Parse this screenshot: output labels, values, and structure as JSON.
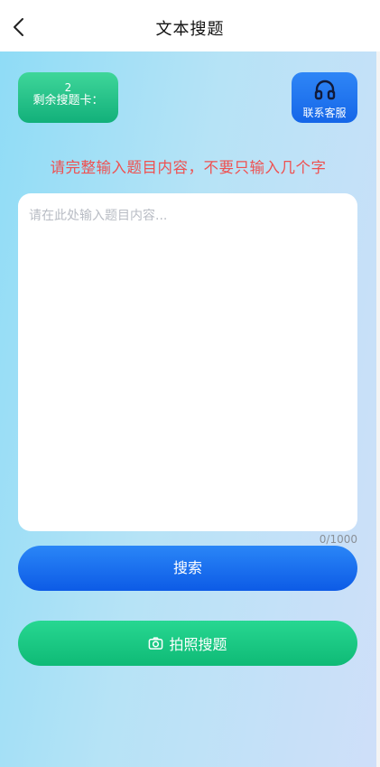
{
  "header": {
    "title": "文本搜题",
    "back_icon": "chevron-left-icon"
  },
  "cards": {
    "remaining_count": "2",
    "remaining_label": "剩余搜题卡：",
    "service_label": "联系客服",
    "service_icon": "headphones-icon"
  },
  "warning": "请完整输入题目内容，不要只输入几个字",
  "input": {
    "placeholder": "请在此处输入题目内容...",
    "value": "",
    "counter": "0/1000"
  },
  "buttons": {
    "search_label": "搜索",
    "photo_label": "拍照搜题",
    "photo_icon": "camera-icon"
  },
  "colors": {
    "green_accent": "#12b07a",
    "blue_accent": "#1566e8",
    "warning_red": "#ef5050"
  }
}
